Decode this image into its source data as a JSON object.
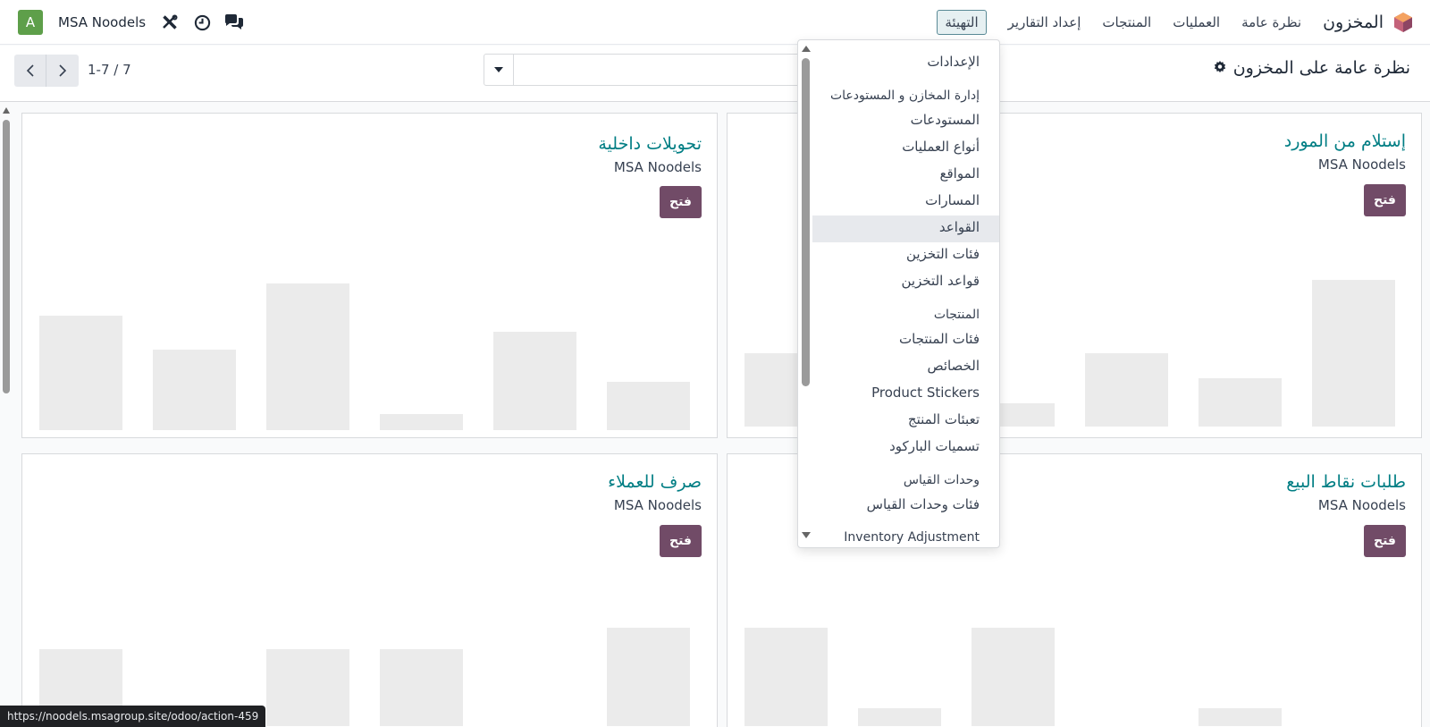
{
  "navbar": {
    "app_title": "المخزون",
    "menu": [
      "نظرة عامة",
      "العمليات",
      "المنتجات",
      "إعداد التقارير",
      "التهيئة"
    ],
    "avatar_letter": "A",
    "company": "MSA Noodels"
  },
  "control": {
    "breadcrumb": "نظرة عامة على المخزون",
    "pager": "1-7 / 7",
    "search_value": ""
  },
  "dropdown": {
    "items": [
      {
        "label": "الإعدادات",
        "kind": "item"
      },
      {
        "label": "إدارة المخازن و المستودعات",
        "kind": "section"
      },
      {
        "label": "المستودعات",
        "kind": "item"
      },
      {
        "label": "أنواع العمليات",
        "kind": "item"
      },
      {
        "label": "المواقع",
        "kind": "item"
      },
      {
        "label": "المسارات",
        "kind": "item"
      },
      {
        "label": "القواعد",
        "kind": "item",
        "highlighted": true
      },
      {
        "label": "فئات التخزين",
        "kind": "item"
      },
      {
        "label": "قواعد التخزين",
        "kind": "item"
      },
      {
        "label": "المنتجات",
        "kind": "section"
      },
      {
        "label": "فئات المنتجات",
        "kind": "item"
      },
      {
        "label": "الخصائص",
        "kind": "item"
      },
      {
        "label": "Product Stickers",
        "kind": "item"
      },
      {
        "label": "تعبئات المنتج",
        "kind": "item"
      },
      {
        "label": "تسميات الباركود",
        "kind": "item"
      },
      {
        "label": "وحدات القياس",
        "kind": "section"
      },
      {
        "label": "فئات وحدات القياس",
        "kind": "item"
      },
      {
        "label": "Inventory Adjustment",
        "kind": "section"
      }
    ]
  },
  "cards": [
    {
      "title": "إستلام من المورد",
      "subtitle": "MSA Noodels",
      "button": "فتح",
      "bars": [
        0.41,
        0.0,
        0.13,
        0.41,
        0.27,
        0.82
      ]
    },
    {
      "title": "تحويلات داخلية",
      "subtitle": "MSA Noodels",
      "button": "فتح",
      "bars": [
        0.64,
        0.45,
        0.82,
        0.09,
        0.55,
        0.27
      ]
    },
    {
      "title": "طلبات نقاط البيع",
      "subtitle": "MSA Noodels",
      "button": "فتح",
      "bars": [
        0.55,
        0.1,
        0.55,
        0.0,
        0.1,
        0.0
      ]
    },
    {
      "title": "صرف للعملاء",
      "subtitle": "MSA Noodels",
      "button": "فتح",
      "bars": [
        0.43,
        0.0,
        0.43,
        0.43,
        0.0,
        0.55
      ]
    }
  ],
  "status_url": "https://noodels.msagroup.site/odoo/action-459",
  "colors": {
    "accent": "#714b67",
    "title": "#017e84",
    "avatar": "#5e9f4a"
  }
}
